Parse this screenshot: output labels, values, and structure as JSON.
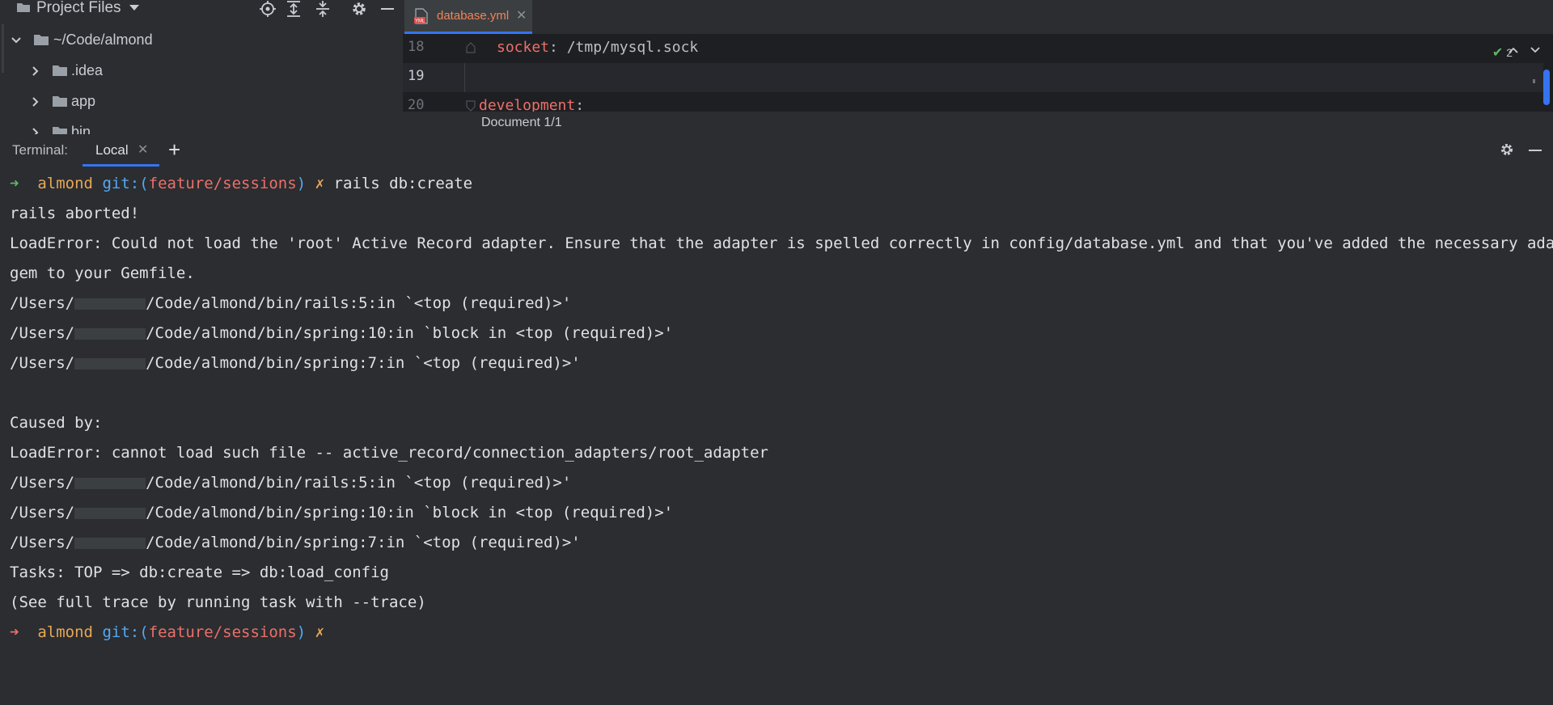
{
  "project": {
    "title": "Project Files",
    "tree": [
      {
        "label": "~/Code/almond",
        "expanded": true
      },
      {
        "label": ".idea",
        "expanded": false
      },
      {
        "label": "app",
        "expanded": false
      },
      {
        "label": "bin",
        "expanded": false
      }
    ]
  },
  "editor": {
    "tab_name": "database.yml",
    "lines": [
      {
        "num": "18",
        "key": "socket",
        "value": ": /tmp/mysql.sock"
      },
      {
        "num": "19",
        "key": "",
        "value": ""
      },
      {
        "num": "20",
        "key": "development",
        "value": ":"
      }
    ],
    "inspection_count": "2",
    "doc_status": "Document 1/1"
  },
  "terminal": {
    "label": "Terminal:",
    "tab_label": "Local",
    "prompt": {
      "dir": "almond",
      "git": "git:",
      "branch_open": "(",
      "branch": "feature/sessions",
      "branch_close": ")",
      "dirty": "✗"
    },
    "command": "rails db:create",
    "output": [
      "rails aborted!",
      "LoadError: Could not load the 'root' Active Record adapter. Ensure that the adapter is spelled correctly in config/database.yml and that you've added the necessary adapter",
      "gem to your Gemfile.",
      "/Users/",
      "/Code/almond/bin/rails:5:in `<top (required)>'",
      "/Code/almond/bin/spring:10:in `block in <top (required)>'",
      "/Code/almond/bin/spring:7:in `<top (required)>'",
      "Caused by:",
      "LoadError: cannot load such file -- active_record/connection_adapters/root_adapter",
      "Tasks: TOP => db:create => db:load_config",
      "(See full trace by running task with --trace)"
    ]
  },
  "colors": {
    "accent": "#3574f0",
    "prompt_dir": "#e8a657",
    "git": "#56a8f5",
    "branch": "#ed6f6a",
    "ok": "#5fb865"
  }
}
